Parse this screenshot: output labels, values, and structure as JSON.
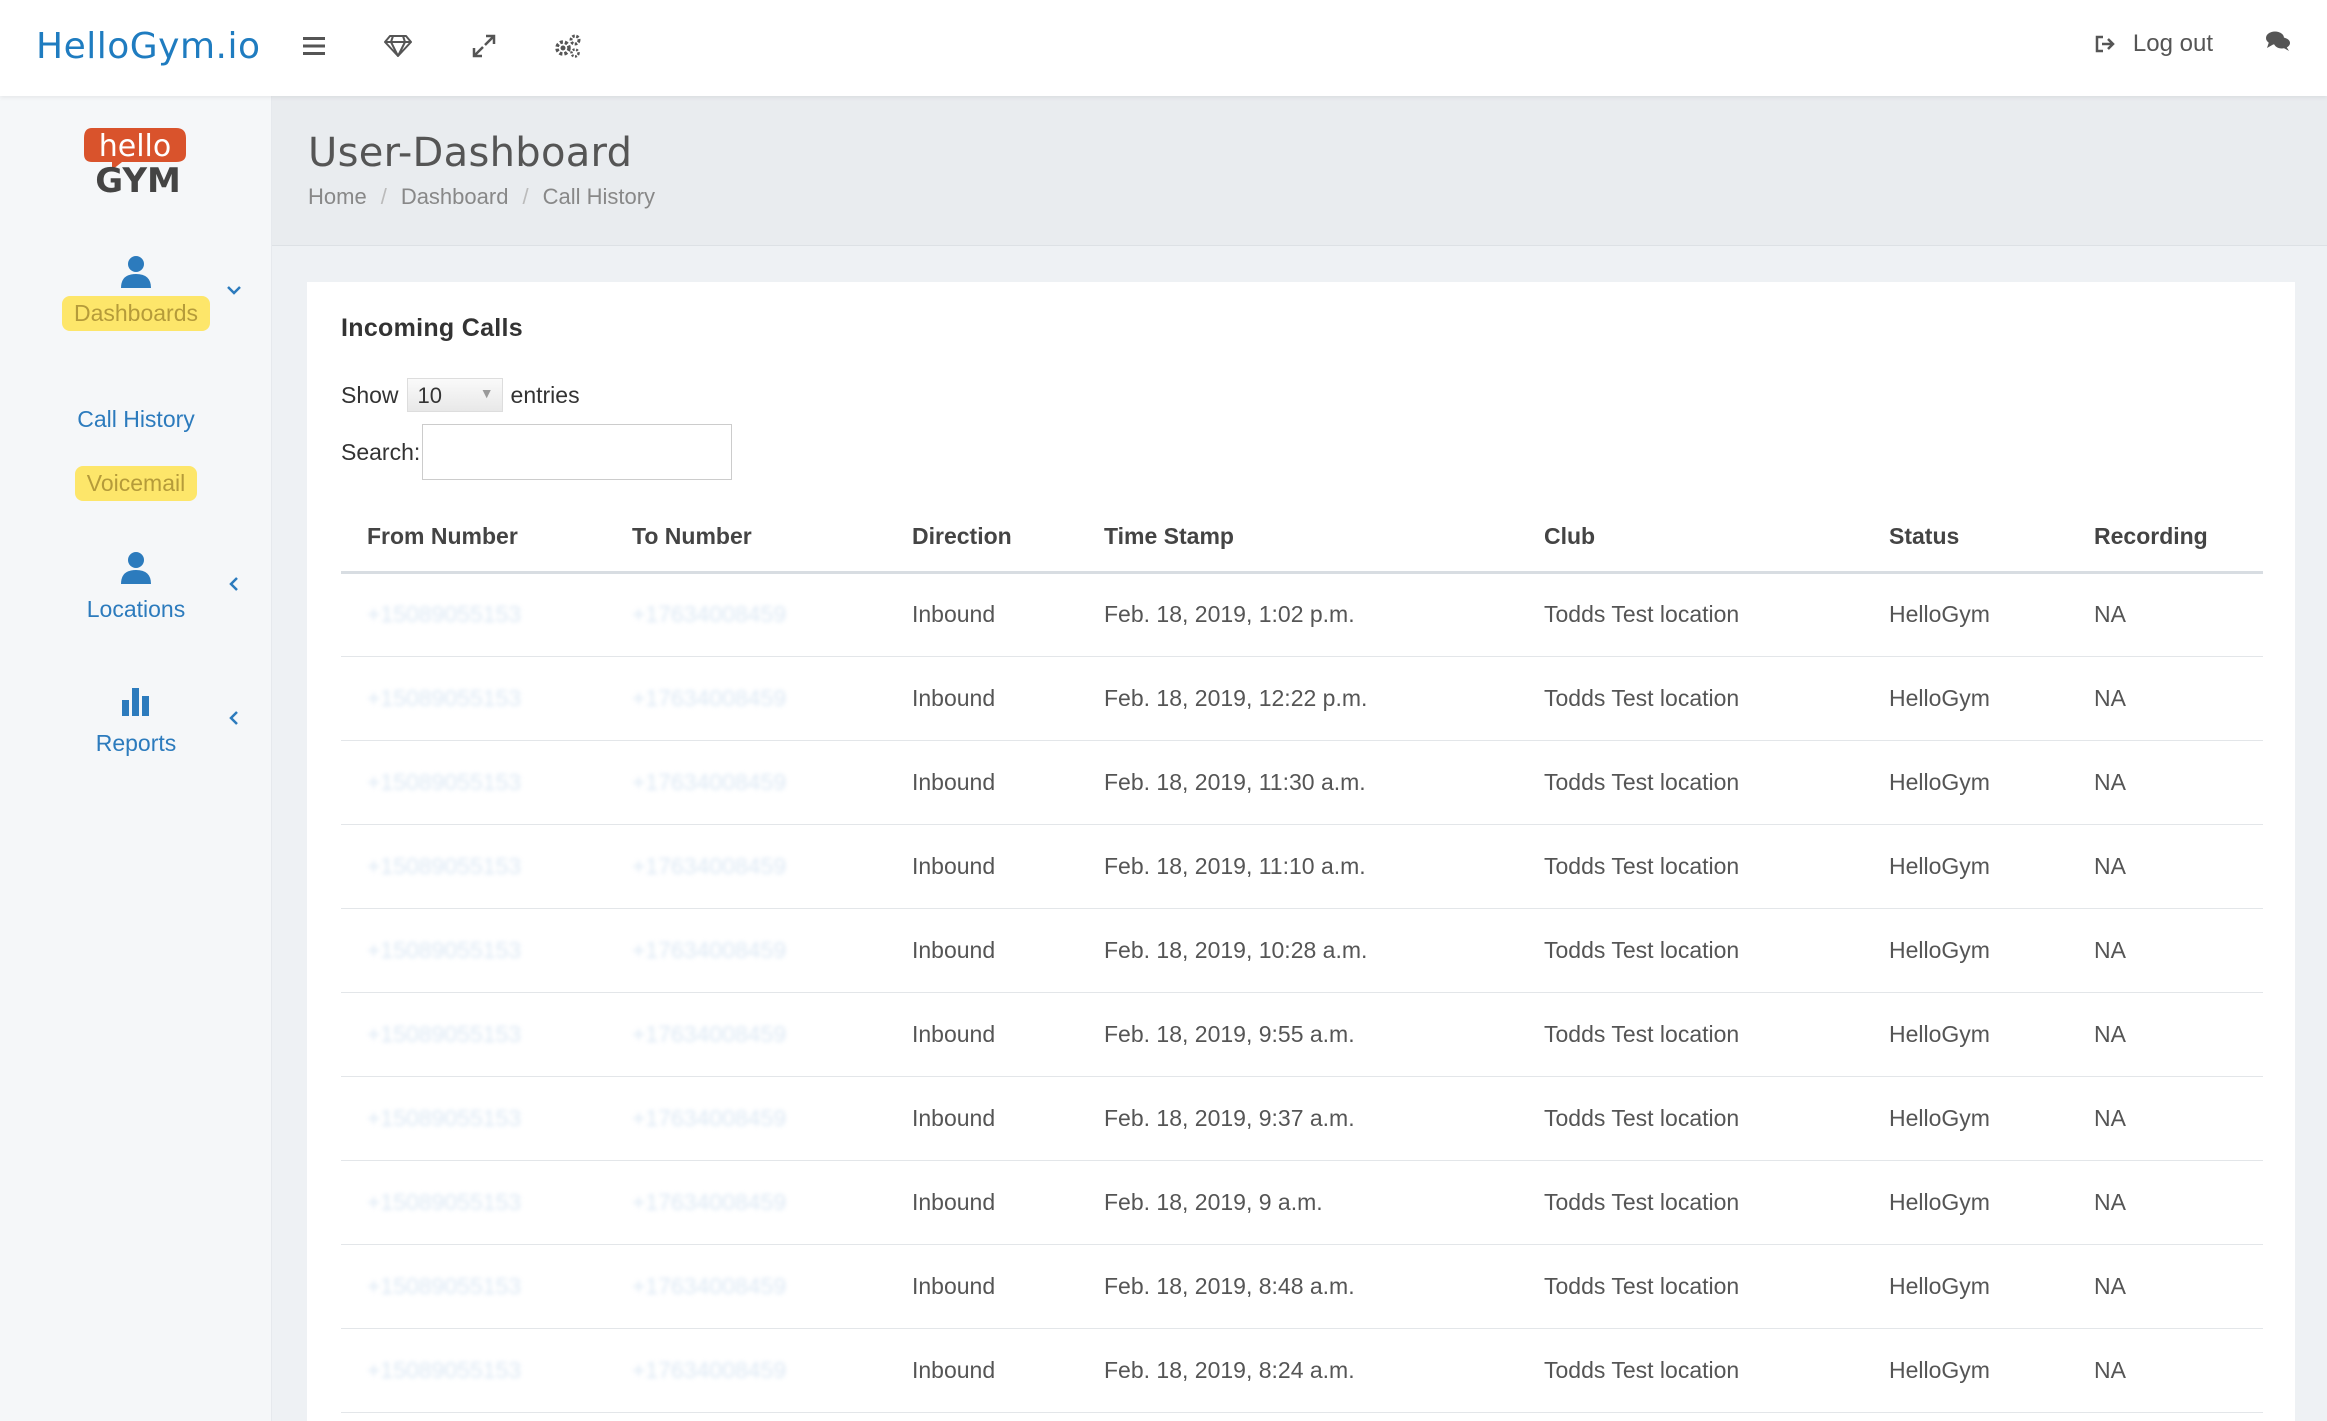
{
  "app": {
    "brand": "HelloGym.io"
  },
  "topbar": {
    "logout_label": "Log out"
  },
  "sidebar": {
    "logo_text_top": "hello",
    "logo_text_bottom": "GYM",
    "items": [
      {
        "label": "Dashboards",
        "icon": "user-icon",
        "highlighted": true
      },
      {
        "label": "Call History"
      },
      {
        "label": "Voicemail",
        "highlighted": true
      },
      {
        "label": "Locations",
        "icon": "user-icon"
      },
      {
        "label": "Reports",
        "icon": "bar-chart-icon"
      }
    ]
  },
  "header": {
    "title": "User-Dashboard",
    "breadcrumb": [
      "Home",
      "Dashboard",
      "Call History"
    ]
  },
  "panel": {
    "title": "Incoming Calls",
    "show_label": "Show",
    "entries_value": "10",
    "entries_label": "entries",
    "search_label": "Search:",
    "search_value": ""
  },
  "table": {
    "headers": [
      "From Number",
      "To Number",
      "Direction",
      "Time Stamp",
      "Club",
      "Status",
      "Recording"
    ],
    "rows": [
      {
        "from": "+15089055153",
        "to": "+17634008459",
        "direction": "Inbound",
        "time": "Feb. 18, 2019, 1:02 p.m.",
        "club": "Todds Test location",
        "status": "HelloGym",
        "recording": "NA"
      },
      {
        "from": "+15089055153",
        "to": "+17634008459",
        "direction": "Inbound",
        "time": "Feb. 18, 2019, 12:22 p.m.",
        "club": "Todds Test location",
        "status": "HelloGym",
        "recording": "NA"
      },
      {
        "from": "+15089055153",
        "to": "+17634008459",
        "direction": "Inbound",
        "time": "Feb. 18, 2019, 11:30 a.m.",
        "club": "Todds Test location",
        "status": "HelloGym",
        "recording": "NA"
      },
      {
        "from": "+15089055153",
        "to": "+17634008459",
        "direction": "Inbound",
        "time": "Feb. 18, 2019, 11:10 a.m.",
        "club": "Todds Test location",
        "status": "HelloGym",
        "recording": "NA"
      },
      {
        "from": "+15089055153",
        "to": "+17634008459",
        "direction": "Inbound",
        "time": "Feb. 18, 2019, 10:28 a.m.",
        "club": "Todds Test location",
        "status": "HelloGym",
        "recording": "NA"
      },
      {
        "from": "+15089055153",
        "to": "+17634008459",
        "direction": "Inbound",
        "time": "Feb. 18, 2019, 9:55 a.m.",
        "club": "Todds Test location",
        "status": "HelloGym",
        "recording": "NA"
      },
      {
        "from": "+15089055153",
        "to": "+17634008459",
        "direction": "Inbound",
        "time": "Feb. 18, 2019, 9:37 a.m.",
        "club": "Todds Test location",
        "status": "HelloGym",
        "recording": "NA"
      },
      {
        "from": "+15089055153",
        "to": "+17634008459",
        "direction": "Inbound",
        "time": "Feb. 18, 2019, 9 a.m.",
        "club": "Todds Test location",
        "status": "HelloGym",
        "recording": "NA"
      },
      {
        "from": "+15089055153",
        "to": "+17634008459",
        "direction": "Inbound",
        "time": "Feb. 18, 2019, 8:48 a.m.",
        "club": "Todds Test location",
        "status": "HelloGym",
        "recording": "NA"
      },
      {
        "from": "+15089055153",
        "to": "+17634008459",
        "direction": "Inbound",
        "time": "Feb. 18, 2019, 8:24 a.m.",
        "club": "Todds Test location",
        "status": "HelloGym",
        "recording": "NA"
      }
    ]
  }
}
